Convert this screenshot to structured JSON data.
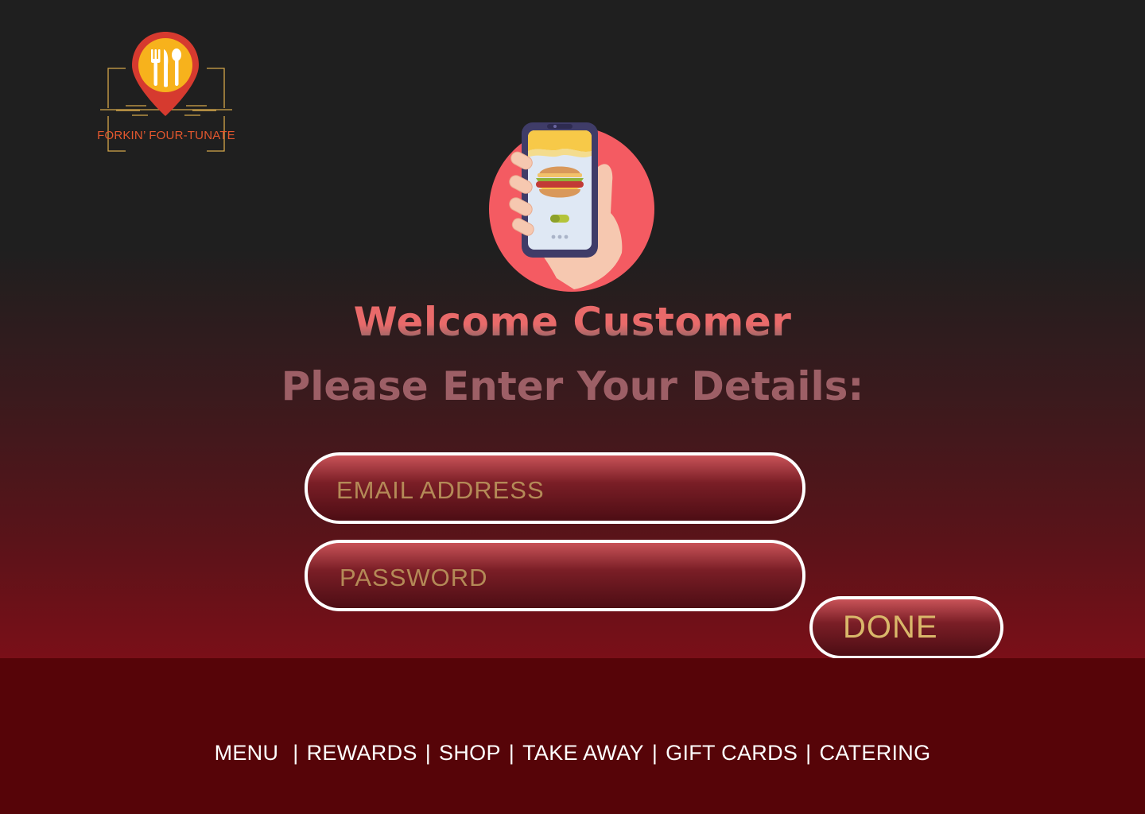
{
  "brand": {
    "name": "FORKIN’ FOUR-TUNATE"
  },
  "hero": {
    "title": "Welcome Customer",
    "subtitle": "Please Enter Your Details:"
  },
  "form": {
    "email_placeholder": "EMAIL ADDRESS",
    "password_placeholder": "PASSWORD",
    "submit_label": "DONE"
  },
  "nav": {
    "items": [
      {
        "label": "MENU"
      },
      {
        "label": "REWARDS"
      },
      {
        "label": "SHOP"
      },
      {
        "label": "TAKE AWAY"
      },
      {
        "label": "GIFT CARDS"
      },
      {
        "label": "CATERING"
      }
    ],
    "separator": "|"
  },
  "colors": {
    "background_dark": "#1f1f1f",
    "footer": "#560408",
    "accent_red": "#e96a6a",
    "pill_border": "#ffffff",
    "placeholder_gold": "#b48a57",
    "button_text": "#d9b76a"
  },
  "icons": {
    "logo": "fork-knife-spoon-pin-icon",
    "hero": "phone-burger-order-icon"
  }
}
